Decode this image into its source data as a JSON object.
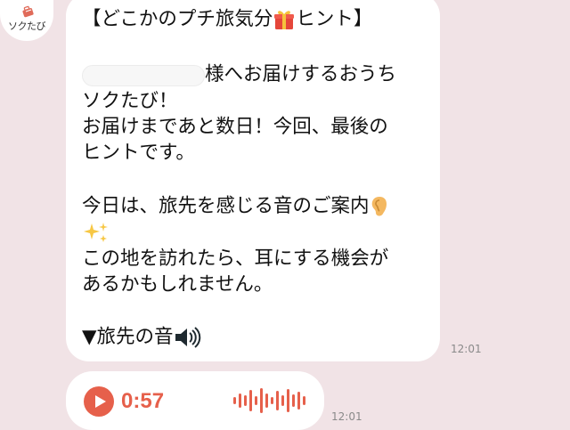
{
  "avatar": {
    "label": "ソクたび",
    "icon": "suitcase-logo-icon",
    "accent": "#e06b5a"
  },
  "message": {
    "lines": [
      "【どこかのプチ旅気分",
      "ヒント】",
      "様へお届けするおうち",
      "ソクたび！",
      "お届けまであと数日！今回、最後の",
      "ヒントです。",
      "今日は、旅先を感じる音のご案内",
      "この地を訪れたら、耳にする機会が",
      "あるかもしれません。",
      "▼旅先の音"
    ],
    "icons": [
      "gift-icon",
      "ear-icon",
      "sparkles-icon",
      "speaker-icon"
    ],
    "time": "12:01"
  },
  "audio": {
    "duration": "0:57",
    "time": "12:01",
    "accent": "#e6604b"
  },
  "colors": {
    "background": "#f1e3e6",
    "bubble": "#ffffff",
    "text": "#111111",
    "timestamp": "#8a8a8a"
  }
}
